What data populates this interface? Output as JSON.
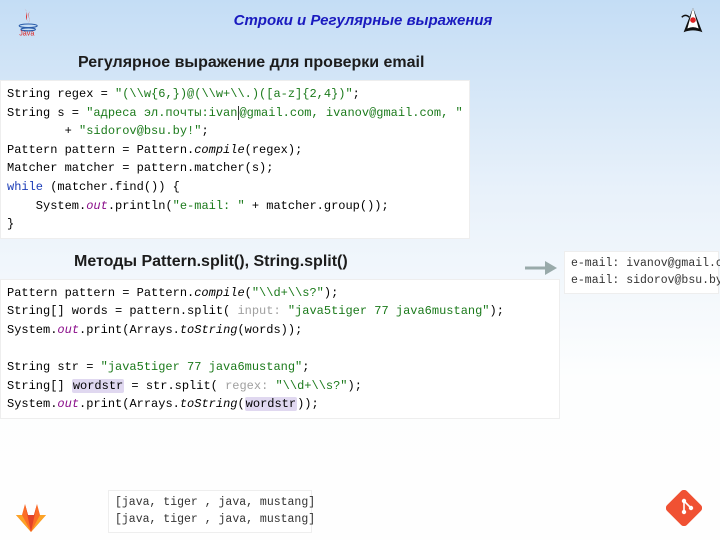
{
  "header": {
    "title": "Строки и Регулярные выражения"
  },
  "section1": {
    "title": "Регулярное выражение для проверки email",
    "code": {
      "l1a": "String regex = ",
      "l1b": "\"(\\\\w{6,})@(\\\\w+\\\\.)([a-z]{2,4})\"",
      "l1c": ";",
      "l2a": "String s = ",
      "l2b": "\"адреса эл.почты:ivan",
      "l2c": "@gmail.com, ivanov@gmail.com, \"",
      "l3a": "        + ",
      "l3b": "\"sidorov@bsu.by!\"",
      "l3c": ";",
      "l4a": "Pattern pattern = Pattern.",
      "l4b": "compile",
      "l4c": "(regex);",
      "l5a": "Matcher matcher = pattern.matcher(s);",
      "l6a": "while",
      "l6b": " (matcher.find()) {",
      "l7a": "    System.",
      "l7b": "out",
      "l7c": ".println(",
      "l7d": "\"e-mail: \"",
      "l7e": " + matcher.group());",
      "l8": "}"
    },
    "output": "e-mail: ivanov@gmail.com\ne-mail: sidorov@bsu.by"
  },
  "section2": {
    "title": "Методы Pattern.split(), String.split()",
    "code": {
      "l1a": "Pattern pattern = Pattern.",
      "l1b": "compile",
      "l1c": "(",
      "l1d": "\"\\\\d+\\\\s?\"",
      "l1e": ");",
      "l2a": "String[] words = pattern.split( ",
      "l2hint": "input: ",
      "l2b": "\"java5tiger 77 java6mustang\"",
      "l2c": ");",
      "l3a": "System.",
      "l3b": "out",
      "l3c": ".print(Arrays.",
      "l3d": "toString",
      "l3e": "(words));",
      "l4": "",
      "l5a": "String str = ",
      "l5b": "\"java5tiger 77 java6mustang\"",
      "l5c": ";",
      "l6a": "String[] ",
      "l6v": "wordstr",
      "l6b": " = str.split( ",
      "l6hint": "regex: ",
      "l6c": "\"\\\\d+\\\\s?\"",
      "l6d": ");",
      "l7a": "System.",
      "l7b": "out",
      "l7c": ".print(Arrays.",
      "l7d": "toString",
      "l7e": "(",
      "l7v": "wordstr",
      "l7f": "));"
    },
    "output": "[java, tiger , java, mustang]\n[java, tiger , java, mustang]"
  }
}
